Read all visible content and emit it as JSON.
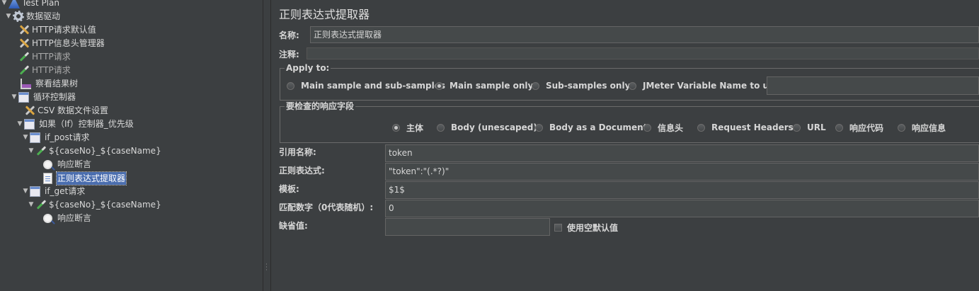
{
  "tree": {
    "items": [
      {
        "label": "Test Plan",
        "icon": "test-plan-icon"
      },
      {
        "label": "数据驱动",
        "icon": "gear-icon"
      },
      {
        "label": "HTTP请求默认值",
        "icon": "wrench-screwdriver-icon"
      },
      {
        "label": "HTTP信息头管理器",
        "icon": "wrench-screwdriver-icon"
      },
      {
        "label": "HTTP请求",
        "icon": "pipette-icon"
      },
      {
        "label": "HTTP请求",
        "icon": "pipette-icon"
      },
      {
        "label": "察看结果树",
        "icon": "graph-icon"
      },
      {
        "label": "循环控制器",
        "icon": "controller-icon"
      },
      {
        "label": "CSV 数据文件设置",
        "icon": "wrench-screwdriver-icon"
      },
      {
        "label": "如果（If）控制器_优先级",
        "icon": "controller-icon"
      },
      {
        "label": "if_post请求",
        "icon": "controller-icon"
      },
      {
        "label": "${caseNo}_${caseName}",
        "icon": "pipette-icon"
      },
      {
        "label": "响应断言",
        "icon": "magnifier-icon"
      },
      {
        "label": "正则表达式提取器",
        "icon": "document-icon"
      },
      {
        "label": "if_get请求",
        "icon": "controller-icon"
      },
      {
        "label": "${caseNo}_${caseName}",
        "icon": "pipette-icon"
      },
      {
        "label": "响应断言",
        "icon": "magnifier-icon"
      }
    ]
  },
  "panel": {
    "title": "正则表达式提取器",
    "name_label": "名称:",
    "name_value": "正则表达式提取器",
    "comment_label": "注释:",
    "comment_value": "",
    "apply_to": {
      "title": "Apply to:",
      "options": [
        "Main sample and sub-samples",
        "Main sample only",
        "Sub-samples only",
        "JMeter Variable Name to use"
      ],
      "selected": "Main sample only",
      "variable_value": ""
    },
    "field_check": {
      "title": "要检查的响应字段",
      "options": [
        "主体",
        "Body (unescaped)",
        "Body as a Document",
        "信息头",
        "Request Headers",
        "URL",
        "响应代码",
        "响应信息"
      ],
      "selected": "主体"
    },
    "ref_name_label": "引用名称:",
    "ref_name_value": "token",
    "regex_label": "正则表达式:",
    "regex_value": "\"token\":\"(.*?)\"",
    "template_label": "模板:",
    "template_value": "$1$",
    "match_no_label": "匹配数字（0代表随机）:",
    "match_no_value": "0",
    "default_label": "缺省值:",
    "default_value": "",
    "use_empty_default_label": "使用空默认值"
  }
}
